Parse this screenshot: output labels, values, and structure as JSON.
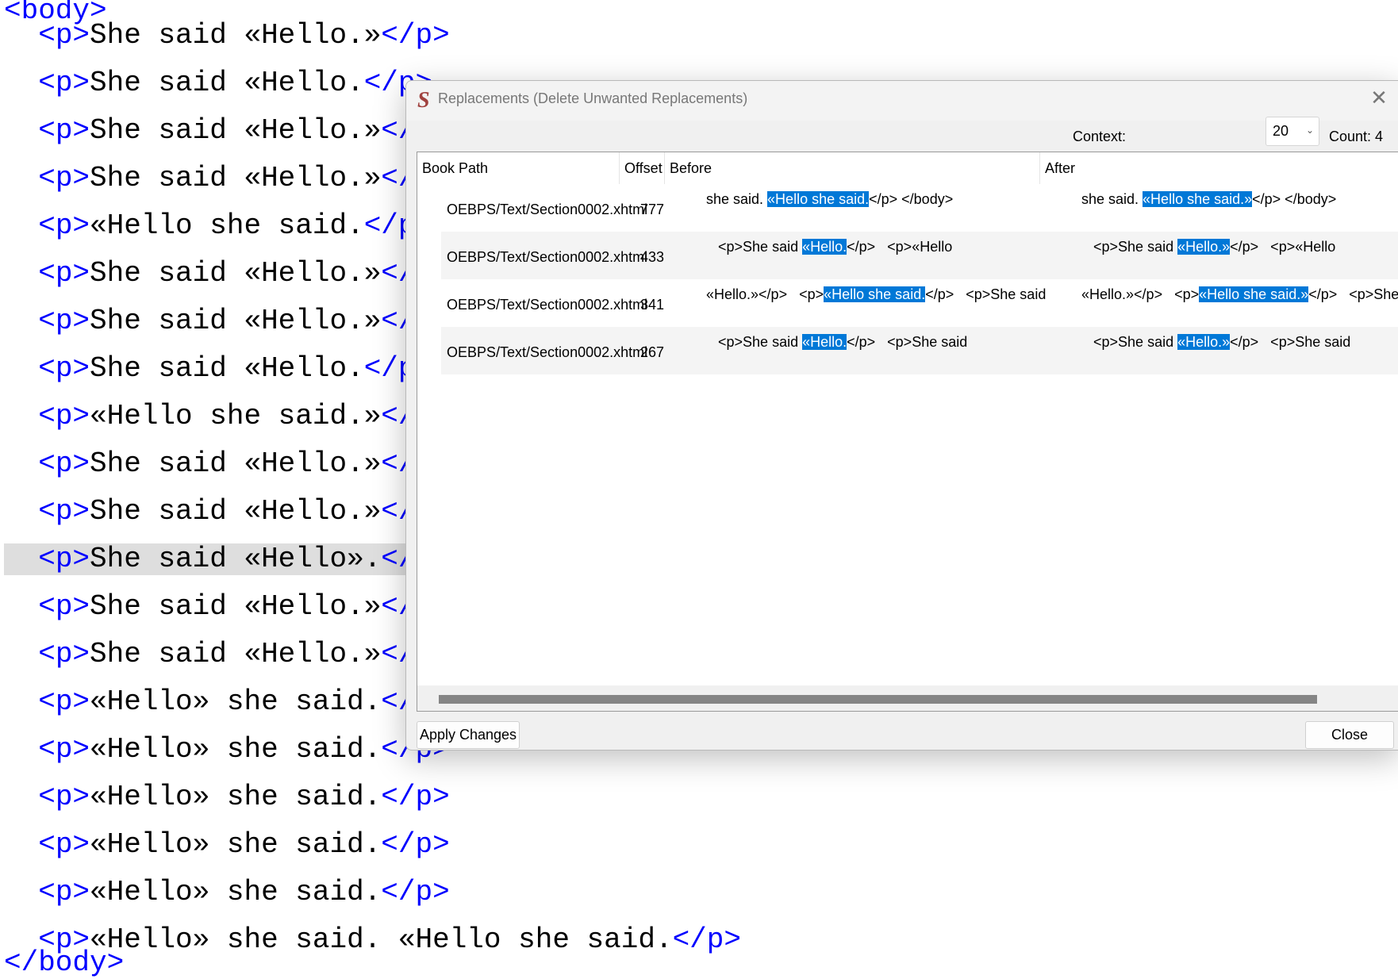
{
  "editor": {
    "body_open": "<body>",
    "body_close": "</body>",
    "p_open": "<p>",
    "p_close": "</p>",
    "current_line_index": 11,
    "lines": [
      "She said «Hello.»",
      "She said «Hello.",
      "She said «Hello.»",
      "She said «Hello.»",
      "«Hello she said.",
      "She said «Hello.»",
      "She said «Hello.»",
      "She said «Hello.",
      "«Hello she said.»",
      "She said «Hello.»",
      "She said «Hello.»",
      "She said «Hello».",
      "She said «Hello.»",
      "She said «Hello.»",
      "«Hello» she said.",
      "«Hello» she said.",
      "«Hello» she said.",
      "«Hello» she said.",
      "«Hello» she said.",
      "«Hello» she said. «Hello she said."
    ]
  },
  "dialog": {
    "app_icon": "S",
    "title": "Replacements (Delete Unwanted Replacements)",
    "context_label": "Context:",
    "context_value": "20",
    "count_label": "Count: 4",
    "columns": [
      "Book Path",
      "Offset",
      "Before",
      "After"
    ],
    "rows": [
      {
        "path": "OEBPS/Text/Section0002.xhtml",
        "offset": "777",
        "before": {
          "pre": "she said. ",
          "hl": "«Hello she said.",
          "post": "</p> </body>"
        },
        "after": {
          "pre": "she said. ",
          "hl": "«Hello she said.»",
          "post": "</p> </body>"
        }
      },
      {
        "path": "OEBPS/Text/Section0002.xhtml",
        "offset": "433",
        "before": {
          "pre": "   <p>She said ",
          "hl": "«Hello.",
          "post": "</p>   <p>«Hello"
        },
        "after": {
          "pre": "   <p>She said ",
          "hl": "«Hello.»",
          "post": "</p>   <p>«Hello"
        }
      },
      {
        "path": "OEBPS/Text/Section0002.xhtml",
        "offset": "341",
        "before": {
          "pre": "«Hello.»</p>   <p>",
          "hl": "«Hello she said.",
          "post": "</p>   <p>She said"
        },
        "after": {
          "pre": "«Hello.»</p>   <p>",
          "hl": "«Hello she said.»",
          "post": "</p>   <p>She said"
        }
      },
      {
        "path": "OEBPS/Text/Section0002.xhtml",
        "offset": "267",
        "before": {
          "pre": "   <p>She said ",
          "hl": "«Hello.",
          "post": "</p>   <p>She said"
        },
        "after": {
          "pre": "   <p>She said ",
          "hl": "«Hello.»",
          "post": "</p>   <p>She said"
        }
      }
    ],
    "apply_label": "Apply Changes",
    "close_label": "Close",
    "highlight_color": "#0078d7"
  }
}
